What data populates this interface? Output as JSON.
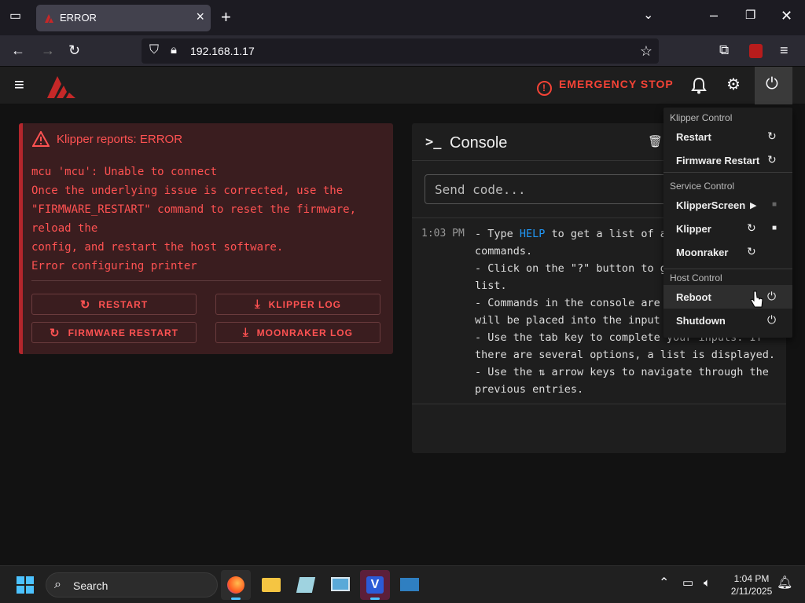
{
  "browser": {
    "tab_title": "ERROR",
    "url": "192.168.1.17"
  },
  "appbar": {
    "emergency_stop_label": "EMERGENCY STOP"
  },
  "error_panel": {
    "title": "Klipper reports: ERROR",
    "lines": [
      "mcu 'mcu': Unable to connect",
      "Once the underlying issue is corrected, use the",
      "\"FIRMWARE_RESTART\" command to reset the firmware,",
      "reload the",
      "config, and restart the host software.",
      "Error configuring printer"
    ],
    "buttons": {
      "restart": "RESTART",
      "klipper_log": "KLIPPER LOG",
      "firmware_restart": "FIRMWARE RESTART",
      "moonraker_log": "MOONRAKER LOG"
    }
  },
  "console": {
    "title": "Console",
    "prompt_glyph": ">_",
    "input_placeholder": "Send code...",
    "entry_time": "1:03 PM",
    "entry_lines": [
      "- Type ",
      "HELP",
      " to get a list of a",
      "commands.",
      "- Click on the \"?\" button to g",
      "list.",
      "- Commands in the console are",
      "will be placed into the input",
      "- Use the tab key to complete your inputs. If",
      "there are several options, a list is displayed.",
      "- Use the ⇅ arrow keys to navigate through the",
      "previous entries."
    ]
  },
  "power_menu": {
    "klipper_control": "Klipper Control",
    "restart": "Restart",
    "firmware_restart": "Firmware Restart",
    "service_control": "Service Control",
    "klipperscreen": "KlipperScreen",
    "klipper": "Klipper",
    "moonraker": "Moonraker",
    "host_control": "Host Control",
    "reboot": "Reboot",
    "shutdown": "Shutdown"
  },
  "taskbar": {
    "search_label": "Search",
    "time": "1:04 PM",
    "date": "2/11/2025"
  },
  "colors": {
    "error_red": "#ff5252",
    "estop_red": "#f44336",
    "help_blue": "#2196f3"
  }
}
